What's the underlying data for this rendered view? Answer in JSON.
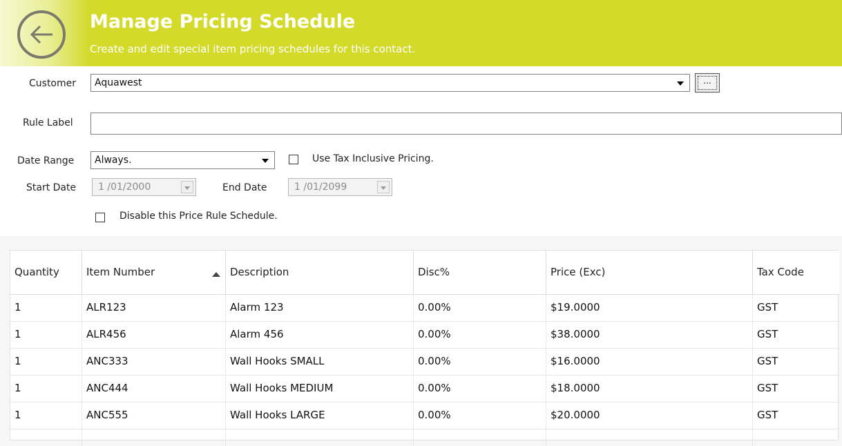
{
  "header": {
    "title": "Manage Pricing Schedule",
    "subtitle": "Create and edit special item pricing schedules for this contact.",
    "back_icon": "arrow-left-icon",
    "accent_color": "#d3da2a"
  },
  "form": {
    "customer_label": "Customer",
    "customer_value": "Aquawest",
    "ellipsis_label": "...",
    "rule_label_label": "Rule Label",
    "rule_label_value": "",
    "date_range_label": "Date Range",
    "date_range_value": "Always.",
    "tax_inclusive_label": "Use Tax Inclusive Pricing.",
    "tax_inclusive_checked": false,
    "start_date_label": "Start Date",
    "start_date_value": "1 /01/2000",
    "end_date_label": "End Date",
    "end_date_value": "1 /01/2099",
    "disable_label": "Disable this Price Rule Schedule.",
    "disable_checked": false
  },
  "grid": {
    "columns": [
      "Quantity",
      "Item Number",
      "Description",
      "Disc%",
      "Price (Exc)",
      "Tax Code"
    ],
    "sort_column": "Item Number",
    "sort_direction": "ascending",
    "rows": [
      [
        "1",
        "ALR123",
        "Alarm 123",
        "0.00%",
        "$19.0000",
        "GST"
      ],
      [
        "1",
        "ALR456",
        "Alarm 456",
        "0.00%",
        "$38.0000",
        "GST"
      ],
      [
        "1",
        "ANC333",
        "Wall Hooks SMALL",
        "0.00%",
        "$16.0000",
        "GST"
      ],
      [
        "1",
        "ANC444",
        "Wall Hooks MEDIUM",
        "0.00%",
        "$18.0000",
        "GST"
      ],
      [
        "1",
        "ANC555",
        "Wall Hooks LARGE",
        "0.00%",
        "$20.0000",
        "GST"
      ]
    ]
  }
}
